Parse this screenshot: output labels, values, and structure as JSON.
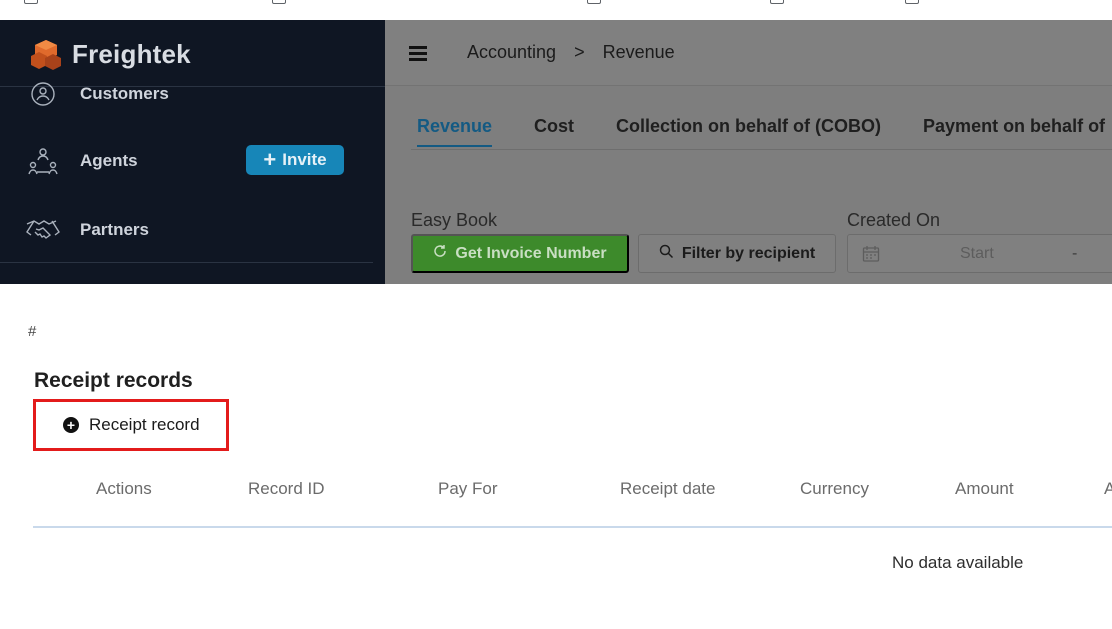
{
  "brand": {
    "name": "Freightek"
  },
  "sidebar": {
    "items": [
      {
        "label": "Customers"
      },
      {
        "label": "Agents"
      },
      {
        "label": "Partners"
      }
    ],
    "invite_label": "Invite"
  },
  "topbar": {
    "breadcrumb": [
      "Accounting",
      ">",
      "Revenue"
    ]
  },
  "tabs": [
    {
      "label": "Revenue",
      "active": true
    },
    {
      "label": "Cost",
      "active": false
    },
    {
      "label": "Collection on behalf of (COBO)",
      "active": false
    },
    {
      "label": "Payment on behalf of",
      "active": false
    }
  ],
  "filters": {
    "easy_book_label": "Easy Book",
    "get_invoice_label": "Get Invoice Number",
    "filter_recipient_label": "Filter by recipient",
    "created_on_label": "Created On",
    "start_placeholder": "Start",
    "range_separator": "-"
  },
  "receipts": {
    "hash": "#",
    "title": "Receipt records",
    "add_label": "Receipt record",
    "columns": [
      "Actions",
      "Record ID",
      "Pay For",
      "Receipt date",
      "Currency",
      "Amount",
      "A"
    ],
    "empty_text": "No data available"
  },
  "colors": {
    "sidebar_bg": "#0f1623",
    "accent_blue": "#1786b8",
    "green": "#3d8a2b",
    "highlight_red": "#e31b1b"
  }
}
